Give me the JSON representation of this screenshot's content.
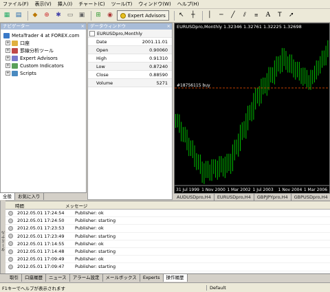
{
  "menu": [
    "ファイル(F)",
    "表示(V)",
    "挿入(I)",
    "チャート(C)",
    "ツール(T)",
    "ウィンドウ(W)",
    "ヘルプ(H)"
  ],
  "toolbar": {
    "expert_advisors_label": "Expert Advisors"
  },
  "navigator": {
    "title": "ナビゲーター",
    "root": "MetaTrader 4 at FOREX.com",
    "items": [
      "口座",
      "罫線分析ツール",
      "Expert Advisors",
      "Custom Indicators",
      "Scripts"
    ],
    "tabs": [
      "全般",
      "お気に入り"
    ]
  },
  "data_window": {
    "title": "データウィンドウ",
    "symbol": "EURUSDpro,Monthly",
    "rows": [
      {
        "label": "Date",
        "value": "2001.11.01"
      },
      {
        "label": "Open",
        "value": "0.90060"
      },
      {
        "label": "High",
        "value": "0.91310"
      },
      {
        "label": "Low",
        "value": "0.87240"
      },
      {
        "label": "Close",
        "value": "0.88590"
      },
      {
        "label": "Volume",
        "value": "5271"
      }
    ]
  },
  "chart": {
    "header": "EURUSDpro,Monthly  1.32346  1.32761  1.32225  1.32698",
    "order_label": "#18756115 buy",
    "x_labels": [
      "31 Jul 1999",
      "1 Nov 2000",
      "1 Mar 2002",
      "1 Jul 2003",
      "1 Nov 2004",
      "1 Mar 2006"
    ],
    "tabs": [
      "AUDUSDpro,H4",
      "EURUSDpro,H4",
      "GBPJPYpro,H4",
      "GBPUSDpro,H4"
    ],
    "colors": {
      "background": "#000000",
      "candle": "#00c000",
      "order_line": "#c04000"
    }
  },
  "chart_data": {
    "type": "candlestick",
    "x": [
      "31 Jul 1999",
      "1 Nov 2000",
      "1 Mar 2002",
      "1 Jul 2003",
      "1 Nov 2004",
      "1 Mar 2006"
    ],
    "approx_close": [
      1.06,
      0.85,
      0.88,
      1.14,
      1.3,
      1.21
    ]
  },
  "terminal": {
    "columns": [
      "時間",
      "メッセージ"
    ],
    "rows": [
      {
        "time": "2012.05.01 17:24:54",
        "msg": "Publisher: ok"
      },
      {
        "time": "2012.05.01 17:24:50",
        "msg": "Publisher: starting"
      },
      {
        "time": "2012.05.01 17:23:53",
        "msg": "Publisher: ok"
      },
      {
        "time": "2012.05.01 17:23:49",
        "msg": "Publisher: starting"
      },
      {
        "time": "2012.05.01 17:14:55",
        "msg": "Publisher: ok"
      },
      {
        "time": "2012.05.01 17:14:48",
        "msg": "Publisher: starting"
      },
      {
        "time": "2012.05.01 17:09:49",
        "msg": "Publisher: ok"
      },
      {
        "time": "2012.05.01 17:09:47",
        "msg": "Publisher: starting"
      }
    ],
    "tabs": [
      "取引",
      "口座履歴",
      "ニュース",
      "アラーム設定",
      "メールボックス",
      "Experts",
      "操作履歴"
    ],
    "side_label": "ターミナル"
  },
  "status": {
    "help": "F1キーでヘルプが表示されます",
    "profile": "Default"
  }
}
